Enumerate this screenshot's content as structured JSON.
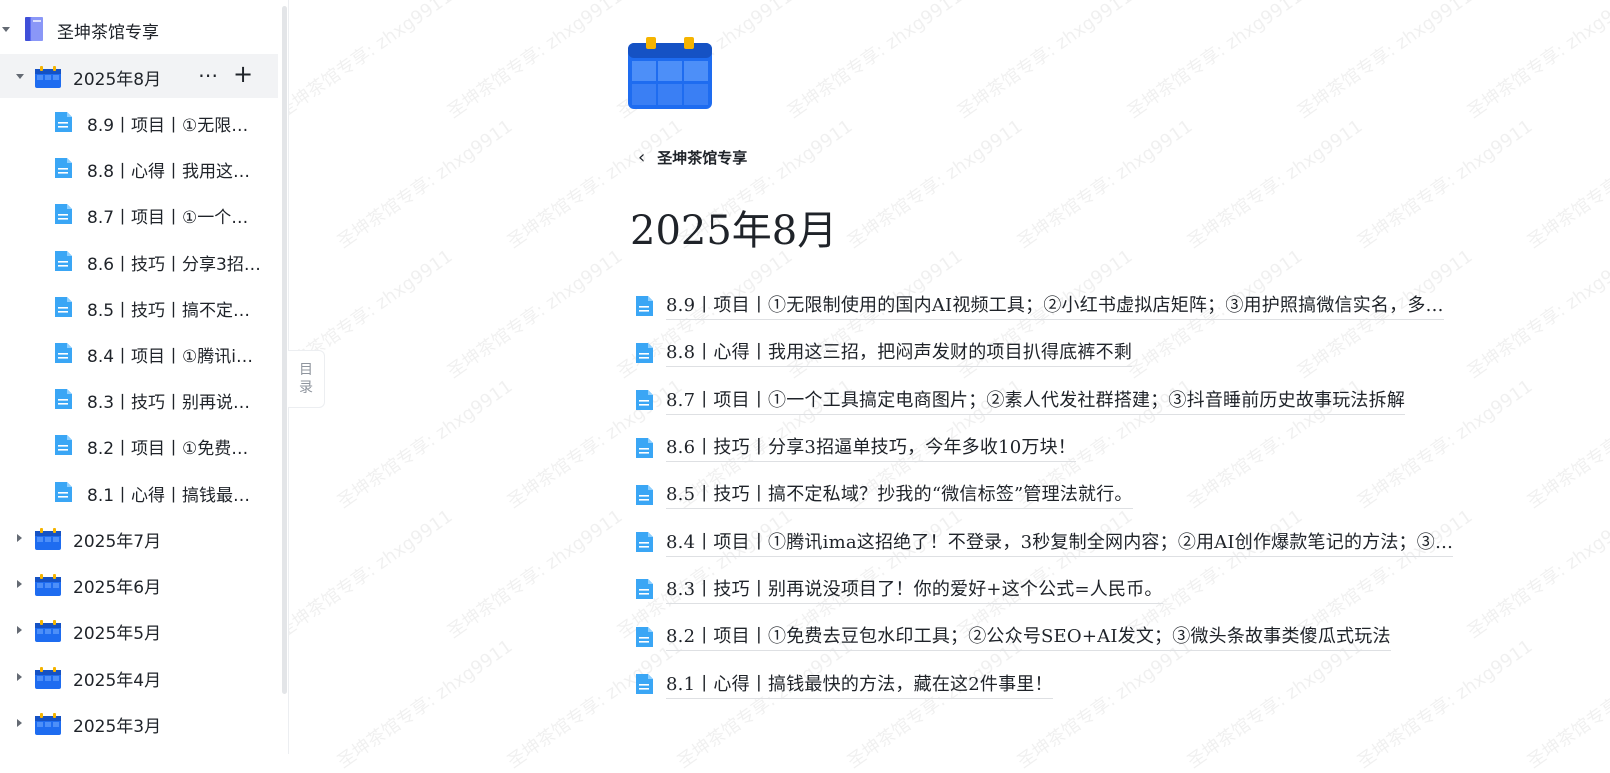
{
  "sidebar": {
    "kb_title": "圣坤茶馆专享",
    "active_month": {
      "label": "2025年8月",
      "more_label": "⋯",
      "add_label": "+"
    },
    "docs": [
      "8.9丨项目丨①无限…",
      "8.8丨心得丨我用这…",
      "8.7丨项目丨①一个…",
      "8.6丨技巧丨分享3招…",
      "8.5丨技巧丨搞不定…",
      "8.4丨项目丨①腾讯i…",
      "8.3丨技巧丨别再说…",
      "8.2丨项目丨①免费…",
      "8.1丨心得丨搞钱最…"
    ],
    "months": [
      "2025年7月",
      "2025年6月",
      "2025年5月",
      "2025年4月",
      "2025年3月"
    ]
  },
  "toc_tab": {
    "line1": "目",
    "line2": "录"
  },
  "main": {
    "back_label": "圣坤茶馆专享",
    "title": "2025年8月",
    "docs": [
      "8.9丨项目丨①无限制使用的国内AI视频工具；②小红书虚拟店矩阵；③用护照搞微信实名，多…",
      "8.8丨心得丨我用这三招，把闷声发财的项目扒得底裤不剩",
      "8.7丨项目丨①一个工具搞定电商图片；②素人代发社群搭建；③抖音睡前历史故事玩法拆解",
      "8.6丨技巧丨分享3招逼单技巧，今年多收10万块！",
      "8.5丨技巧丨搞不定私域？抄我的“微信标签”管理法就行。",
      "8.4丨项目丨①腾讯ima这招绝了！不登录，3秒复制全网内容；②用AI创作爆款笔记的方法；③…",
      "8.3丨技巧丨别再说没项目了！你的爱好+这个公式=人民币。",
      "8.2丨项目丨①免费去豆包水印工具；②公众号SEO+AI发文；③微头条故事类傻瓜式玩法",
      "8.1丨心得丨搞钱最快的方法，藏在这2件事里！"
    ]
  },
  "watermark": "圣坤茶馆专享: zhxg9911",
  "colors": {
    "calendar_blue": "#1e6cf0",
    "calendar_light": "#4d8ff8",
    "calendar_ring": "#f5b400",
    "doc_blue": "#3aa6f5",
    "book_purple": "#5b6cf0"
  }
}
